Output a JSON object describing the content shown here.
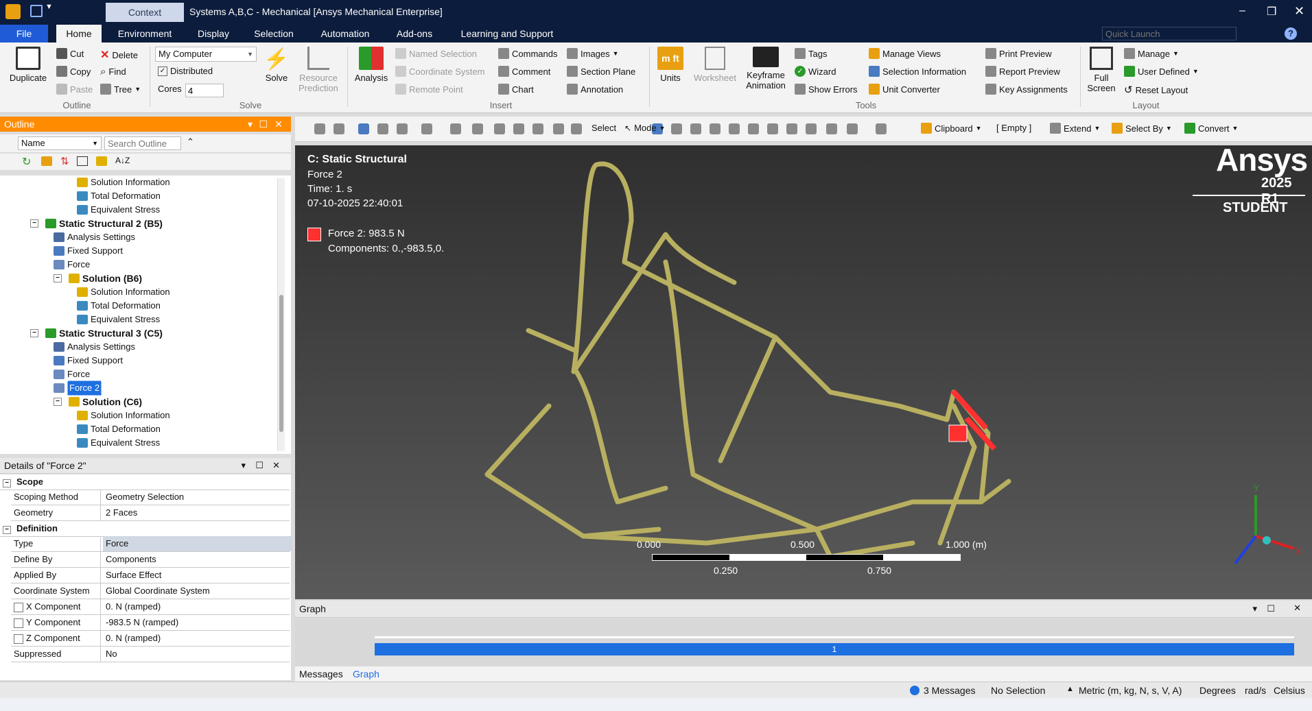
{
  "titlebar": {
    "context_tab": "Context",
    "title": "Systems A,B,C - Mechanical [Ansys Mechanical Enterprise]",
    "minimize": "–",
    "restore": "❐",
    "close": "✕"
  },
  "menu": [
    "File",
    "Home",
    "Environment",
    "Display",
    "Selection",
    "Automation",
    "Add-ons",
    "Learning and Support"
  ],
  "quick_launch": {
    "placeholder": "Quick Launch"
  },
  "ribbon": {
    "outline": {
      "duplicate": "Duplicate",
      "cut": "Cut",
      "copy": "Copy",
      "paste": "Paste",
      "delete": "Delete",
      "find": "Find",
      "tree": "Tree",
      "group": "Outline"
    },
    "solve": {
      "computer": "My Computer",
      "distributed": "Distributed",
      "cores_label": "Cores",
      "cores_value": "4",
      "solve": "Solve",
      "resource_prediction": "Resource Prediction",
      "group": "Solve"
    },
    "insert": {
      "analysis": "Analysis",
      "named_selection": "Named Selection",
      "coordinate_system": "Coordinate System",
      "remote_point": "Remote Point",
      "commands": "Commands",
      "comment": "Comment",
      "chart": "Chart",
      "images": "Images",
      "section_plane": "Section Plane",
      "annotation": "Annotation",
      "group": "Insert"
    },
    "tools": {
      "units": "Units",
      "worksheet": "Worksheet",
      "keyframe": "Keyframe Animation",
      "tags": "Tags",
      "wizard": "Wizard",
      "show_errors": "Show Errors",
      "manage_views": "Manage Views",
      "selection_information": "Selection Information",
      "unit_converter": "Unit Converter",
      "print_preview": "Print Preview",
      "report_preview": "Report Preview",
      "key_assignments": "Key Assignments",
      "group": "Tools"
    },
    "layout": {
      "full_screen": "Full Screen",
      "manage": "Manage",
      "user_defined": "User Defined",
      "reset_layout": "Reset Layout",
      "group": "Layout"
    }
  },
  "outline_panel": {
    "title": "Outline",
    "name_filter": "Name",
    "search_placeholder": "Search Outline",
    "sort": "A↓Z"
  },
  "tree": [
    {
      "label": "Solution Information",
      "bold": false,
      "icon": "solution-info",
      "indent": 3
    },
    {
      "label": "Total Deformation",
      "bold": false,
      "icon": "result",
      "indent": 3
    },
    {
      "label": "Equivalent Stress",
      "bold": false,
      "icon": "result",
      "indent": 3
    },
    {
      "label": "Static Structural 2 (B5)",
      "bold": true,
      "icon": "static-structural",
      "indent": 1
    },
    {
      "label": "Analysis Settings",
      "bold": false,
      "icon": "analysis-settings",
      "indent": 2
    },
    {
      "label": "Fixed Support",
      "bold": false,
      "icon": "support",
      "indent": 2
    },
    {
      "label": "Force",
      "bold": false,
      "icon": "force",
      "indent": 2
    },
    {
      "label": "Solution (B6)",
      "bold": true,
      "icon": "solution",
      "indent": 2
    },
    {
      "label": "Solution Information",
      "bold": false,
      "icon": "solution-info",
      "indent": 3
    },
    {
      "label": "Total Deformation",
      "bold": false,
      "icon": "result",
      "indent": 3
    },
    {
      "label": "Equivalent Stress",
      "bold": false,
      "icon": "result",
      "indent": 3
    },
    {
      "label": "Static Structural 3 (C5)",
      "bold": true,
      "icon": "static-structural",
      "indent": 1
    },
    {
      "label": "Analysis Settings",
      "bold": false,
      "icon": "analysis-settings",
      "indent": 2
    },
    {
      "label": "Fixed Support",
      "bold": false,
      "icon": "support",
      "indent": 2
    },
    {
      "label": "Force",
      "bold": false,
      "icon": "force",
      "indent": 2
    },
    {
      "label": "Force 2",
      "bold": false,
      "icon": "force",
      "indent": 2,
      "selected": true
    },
    {
      "label": "Solution (C6)",
      "bold": true,
      "icon": "solution",
      "indent": 2
    },
    {
      "label": "Solution Information",
      "bold": false,
      "icon": "solution-info",
      "indent": 3
    },
    {
      "label": "Total Deformation",
      "bold": false,
      "icon": "result",
      "indent": 3
    },
    {
      "label": "Equivalent Stress",
      "bold": false,
      "icon": "result",
      "indent": 3
    }
  ],
  "details": {
    "title": "Details of \"Force 2\"",
    "scope_label": "Scope",
    "scope": [
      {
        "k": "Scoping Method",
        "v": "Geometry Selection"
      },
      {
        "k": "Geometry",
        "v": "2 Faces"
      }
    ],
    "definition_label": "Definition",
    "definition": [
      {
        "k": "Type",
        "v": "Force",
        "checkbox": false
      },
      {
        "k": "Define By",
        "v": "Components",
        "checkbox": false
      },
      {
        "k": "Applied By",
        "v": "Surface Effect",
        "checkbox": false
      },
      {
        "k": "Coordinate System",
        "v": "Global Coordinate System",
        "checkbox": false
      },
      {
        "k": "X Component",
        "v": "0. N  (ramped)",
        "checkbox": true
      },
      {
        "k": "Y Component",
        "v": "-983.5 N  (ramped)",
        "checkbox": true
      },
      {
        "k": "Z Component",
        "v": "0. N  (ramped)",
        "checkbox": true
      },
      {
        "k": "Suppressed",
        "v": "No",
        "checkbox": false
      }
    ]
  },
  "toolbar": {
    "select": "Select",
    "mode": "Mode",
    "clipboard": "Clipboard",
    "empty": "[ Empty ]",
    "extend": "Extend",
    "select_by": "Select By",
    "convert": "Convert"
  },
  "viewport": {
    "analysis": "C: Static Structural",
    "object": "Force 2",
    "time": "Time: 1. s",
    "date": "07-10-2025 22:40:01",
    "legend_label": "Force 2: 983.5 N",
    "legend_components": "Components: 0.,-983.5,0.",
    "logo": "Ansys",
    "version": "2025 R1",
    "edition": "STUDENT",
    "scale": {
      "t0": "0.000",
      "t1": "0.500",
      "t2": "1.000 (m)",
      "t3": "0.250",
      "t4": "0.750"
    },
    "axes": {
      "x": "X",
      "y": "Y"
    },
    "frame_color": "#b8b060",
    "force_color": "#ff3030"
  },
  "graph": {
    "title": "Graph",
    "step_label": "1",
    "tabs": [
      "Messages",
      "Graph"
    ]
  },
  "status": {
    "messages": "3 Messages",
    "selection": "No Selection",
    "units": "Metric (m, kg, N, s, V, A)",
    "angle": "Degrees",
    "rot": "rad/s",
    "temp": "Celsius"
  },
  "colors": {
    "accent": "#ff8c00",
    "title": "#0c1c3c",
    "file": "#1f5bd6",
    "select": "#1e6fe0"
  }
}
